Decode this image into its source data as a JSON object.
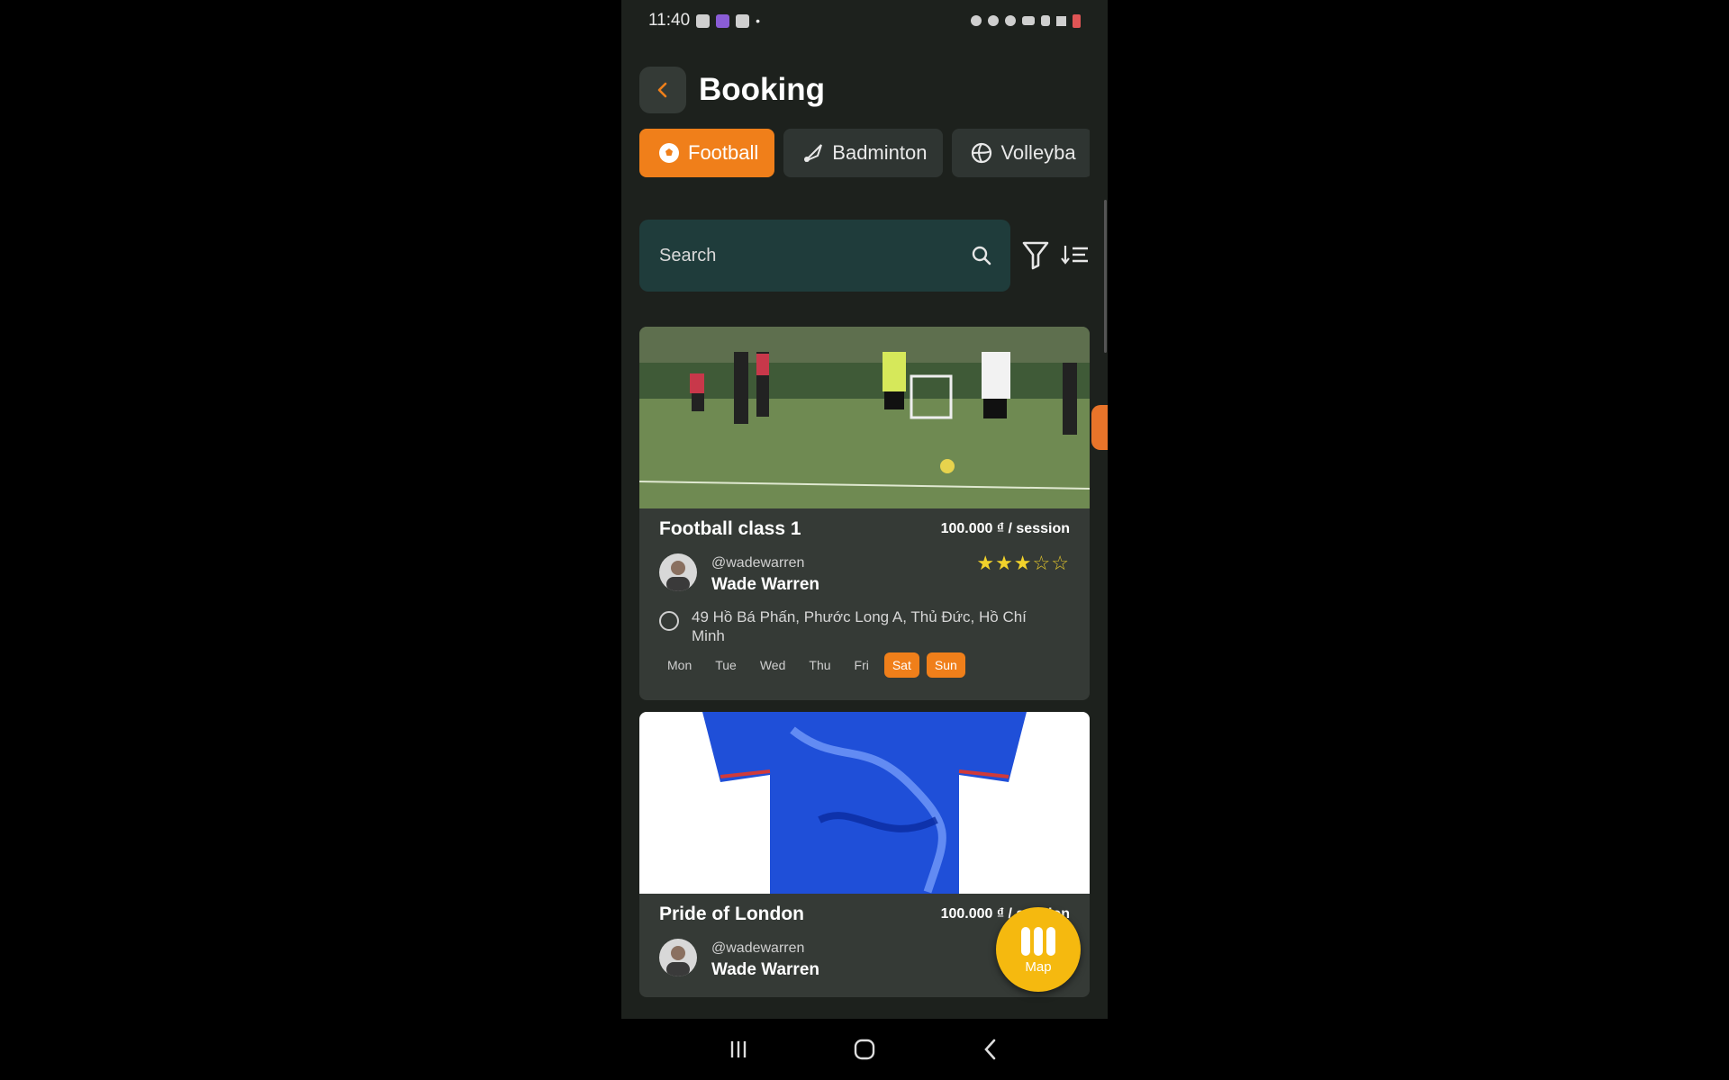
{
  "status_bar": {
    "time": "11:40",
    "dot": "•"
  },
  "header": {
    "title": "Booking"
  },
  "tabs": [
    {
      "label": "Football",
      "icon": "soccer-ball-icon",
      "active": true
    },
    {
      "label": "Badminton",
      "icon": "shuttlecock-icon",
      "active": false
    },
    {
      "label": "Volleyba",
      "icon": "volleyball-icon",
      "active": false
    }
  ],
  "search": {
    "placeholder": "Search"
  },
  "cards": [
    {
      "title": "Football class 1",
      "price": "100.000 ₫ / session",
      "handle": "@wadewarren",
      "name": "Wade Warren",
      "rating": 3,
      "address": "49 Hồ Bá Phấn, Phước Long A, Thủ Đức, Hồ Chí Minh",
      "days": [
        {
          "label": "Mon",
          "active": false
        },
        {
          "label": "Tue",
          "active": false
        },
        {
          "label": "Wed",
          "active": false
        },
        {
          "label": "Thu",
          "active": false
        },
        {
          "label": "Fri",
          "active": false
        },
        {
          "label": "Sat",
          "active": true
        },
        {
          "label": "Sun",
          "active": true
        }
      ]
    },
    {
      "title": "Pride of London",
      "price": "100.000 ₫ / session",
      "handle": "@wadewarren",
      "name": "Wade Warren"
    }
  ],
  "map_button": {
    "label": "Map"
  },
  "colors": {
    "accent": "#f07f1a",
    "star": "#f2d22b",
    "card_bg": "#353a36",
    "search_bg": "#1f3c3b"
  }
}
